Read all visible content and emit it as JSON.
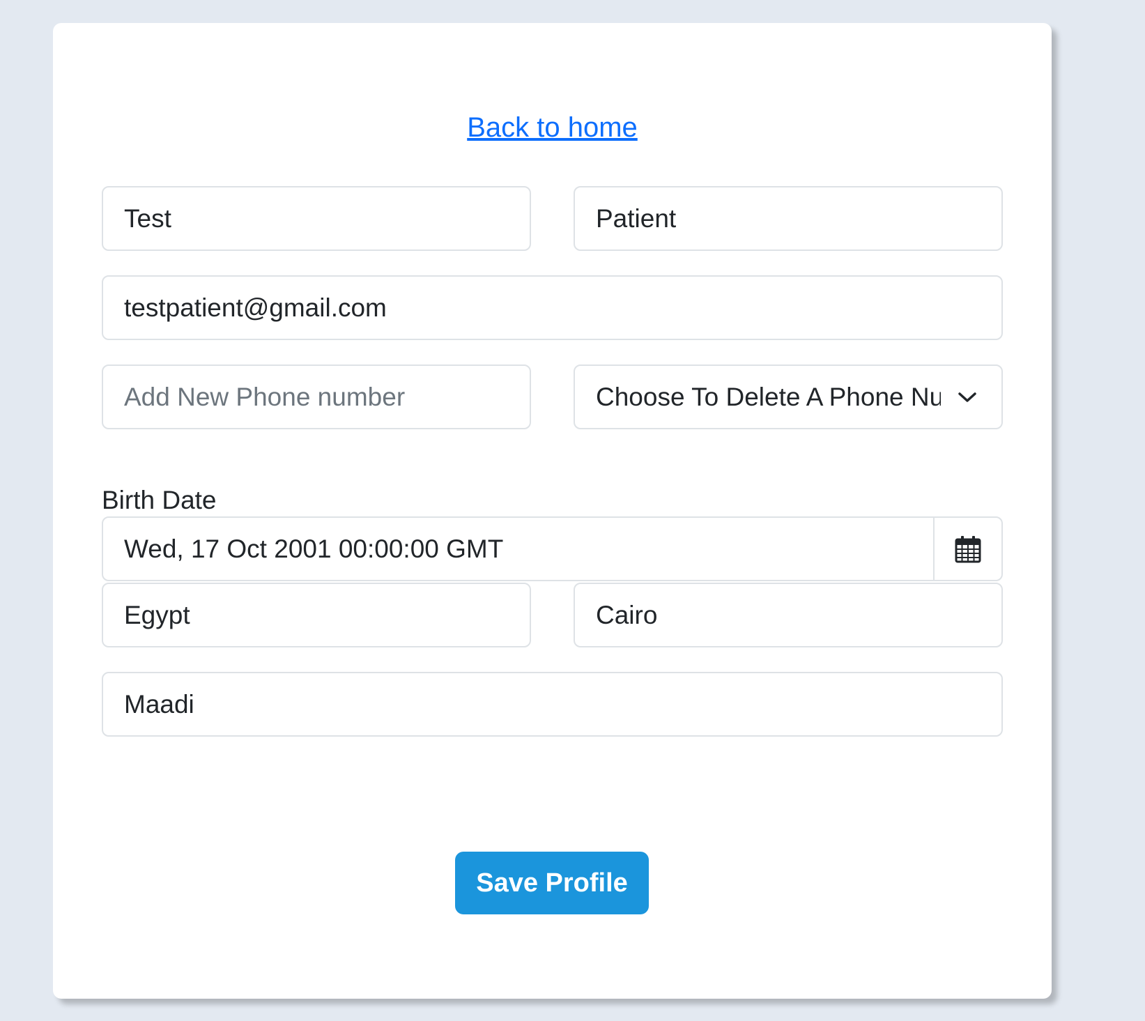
{
  "nav": {
    "back_link": "Back to home"
  },
  "form": {
    "first_name": "Test",
    "last_name": "Patient",
    "email": "testpatient@gmail.com",
    "new_phone_placeholder": "Add New Phone number",
    "delete_phone_select": "Choose To Delete A Phone Number",
    "birth_date_label": "Birth Date",
    "birth_date_value": "Wed, 17 Oct 2001 00:00:00 GMT",
    "country": "Egypt",
    "city": "Cairo",
    "area": "Maadi",
    "save_label": "Save Profile"
  },
  "icons": {
    "calendar": "calendar-icon",
    "chevron": "chevron-down-icon"
  },
  "colors": {
    "link": "#0d6efd",
    "save_button": "#1b95dc",
    "page_background": "#e3e9f1"
  }
}
